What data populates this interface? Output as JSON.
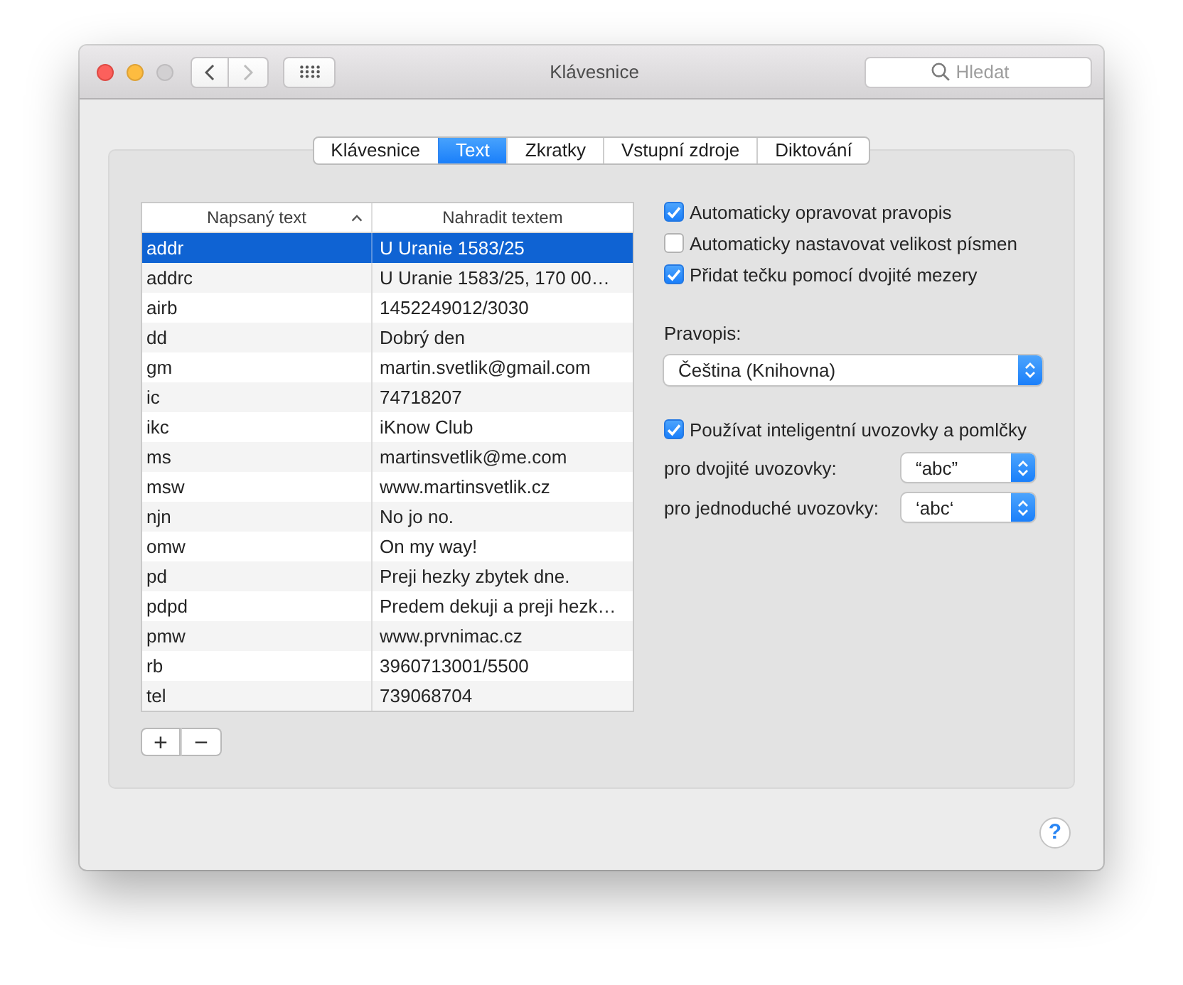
{
  "window": {
    "title": "Klávesnice",
    "buttons": [
      {
        "kind": "close",
        "disabled": false
      },
      {
        "kind": "minimize",
        "disabled": false
      },
      {
        "kind": "zoom",
        "disabled": true
      }
    ],
    "navigation": [
      {
        "kind": "back",
        "disabled": false
      },
      {
        "kind": "forward",
        "disabled": true
      }
    ],
    "search": {
      "placeholder": "Hledat"
    }
  },
  "tabs": [
    {
      "label": "Klávesnice",
      "selected": false
    },
    {
      "label": "Text",
      "selected": true
    },
    {
      "label": "Zkratky",
      "selected": false
    },
    {
      "label": "Vstupní zdroje",
      "selected": false
    },
    {
      "label": "Diktování",
      "selected": false
    }
  ],
  "table": {
    "columns": [
      {
        "label": "Napsaný text",
        "sorted": true
      },
      {
        "label": "Nahradit textem",
        "sorted": false
      }
    ],
    "rows": [
      {
        "cells": [
          "addr",
          "U Uranie 1583/25"
        ],
        "selected": true
      },
      {
        "cells": [
          "addrc",
          "U Uranie 1583/25, 170 00…"
        ],
        "selected": false
      },
      {
        "cells": [
          "airb",
          "1452249012/3030"
        ],
        "selected": false
      },
      {
        "cells": [
          "dd",
          "Dobrý den"
        ],
        "selected": false
      },
      {
        "cells": [
          "gm",
          "martin.svetlik@gmail.com"
        ],
        "selected": false
      },
      {
        "cells": [
          "ic",
          "74718207"
        ],
        "selected": false
      },
      {
        "cells": [
          "ikc",
          "iKnow Club"
        ],
        "selected": false
      },
      {
        "cells": [
          "ms",
          "martinsvetlik@me.com"
        ],
        "selected": false
      },
      {
        "cells": [
          "msw",
          "www.martinsvetlik.cz"
        ],
        "selected": false
      },
      {
        "cells": [
          "njn",
          "No jo no."
        ],
        "selected": false
      },
      {
        "cells": [
          "omw",
          "On my way!"
        ],
        "selected": false
      },
      {
        "cells": [
          "pd",
          "Preji hezky zbytek dne."
        ],
        "selected": false
      },
      {
        "cells": [
          "pdpd",
          "Predem dekuji a preji hezk…"
        ],
        "selected": false
      },
      {
        "cells": [
          "pmw",
          "www.prvnimac.cz"
        ],
        "selected": false
      },
      {
        "cells": [
          "rb",
          "3960713001/5500"
        ],
        "selected": false
      },
      {
        "cells": [
          "tel",
          "739068704"
        ],
        "selected": false
      }
    ]
  },
  "table_buttons": [
    {
      "kind": "add",
      "label": "+"
    },
    {
      "kind": "remove",
      "label": "−"
    }
  ],
  "options": {
    "checkboxes": [
      {
        "label": "Automaticky opravovat pravopis",
        "checked": true
      },
      {
        "label": "Automaticky nastavovat velikost písmen",
        "checked": false
      },
      {
        "label": "Přidat tečku pomocí dvojité mezery",
        "checked": true
      }
    ],
    "spelling": {
      "label": "Pravopis:",
      "value": "Čeština (Knihovna)"
    },
    "smart_quotes": {
      "label": "Používat inteligentní uvozovky a pomlčky",
      "checked": true
    },
    "quotes": [
      {
        "label": "pro dvojité uvozovky:",
        "value": "“abc”"
      },
      {
        "label": "pro jednoduché uvozovky:",
        "value": "‘abc‘"
      }
    ]
  },
  "help": "?"
}
